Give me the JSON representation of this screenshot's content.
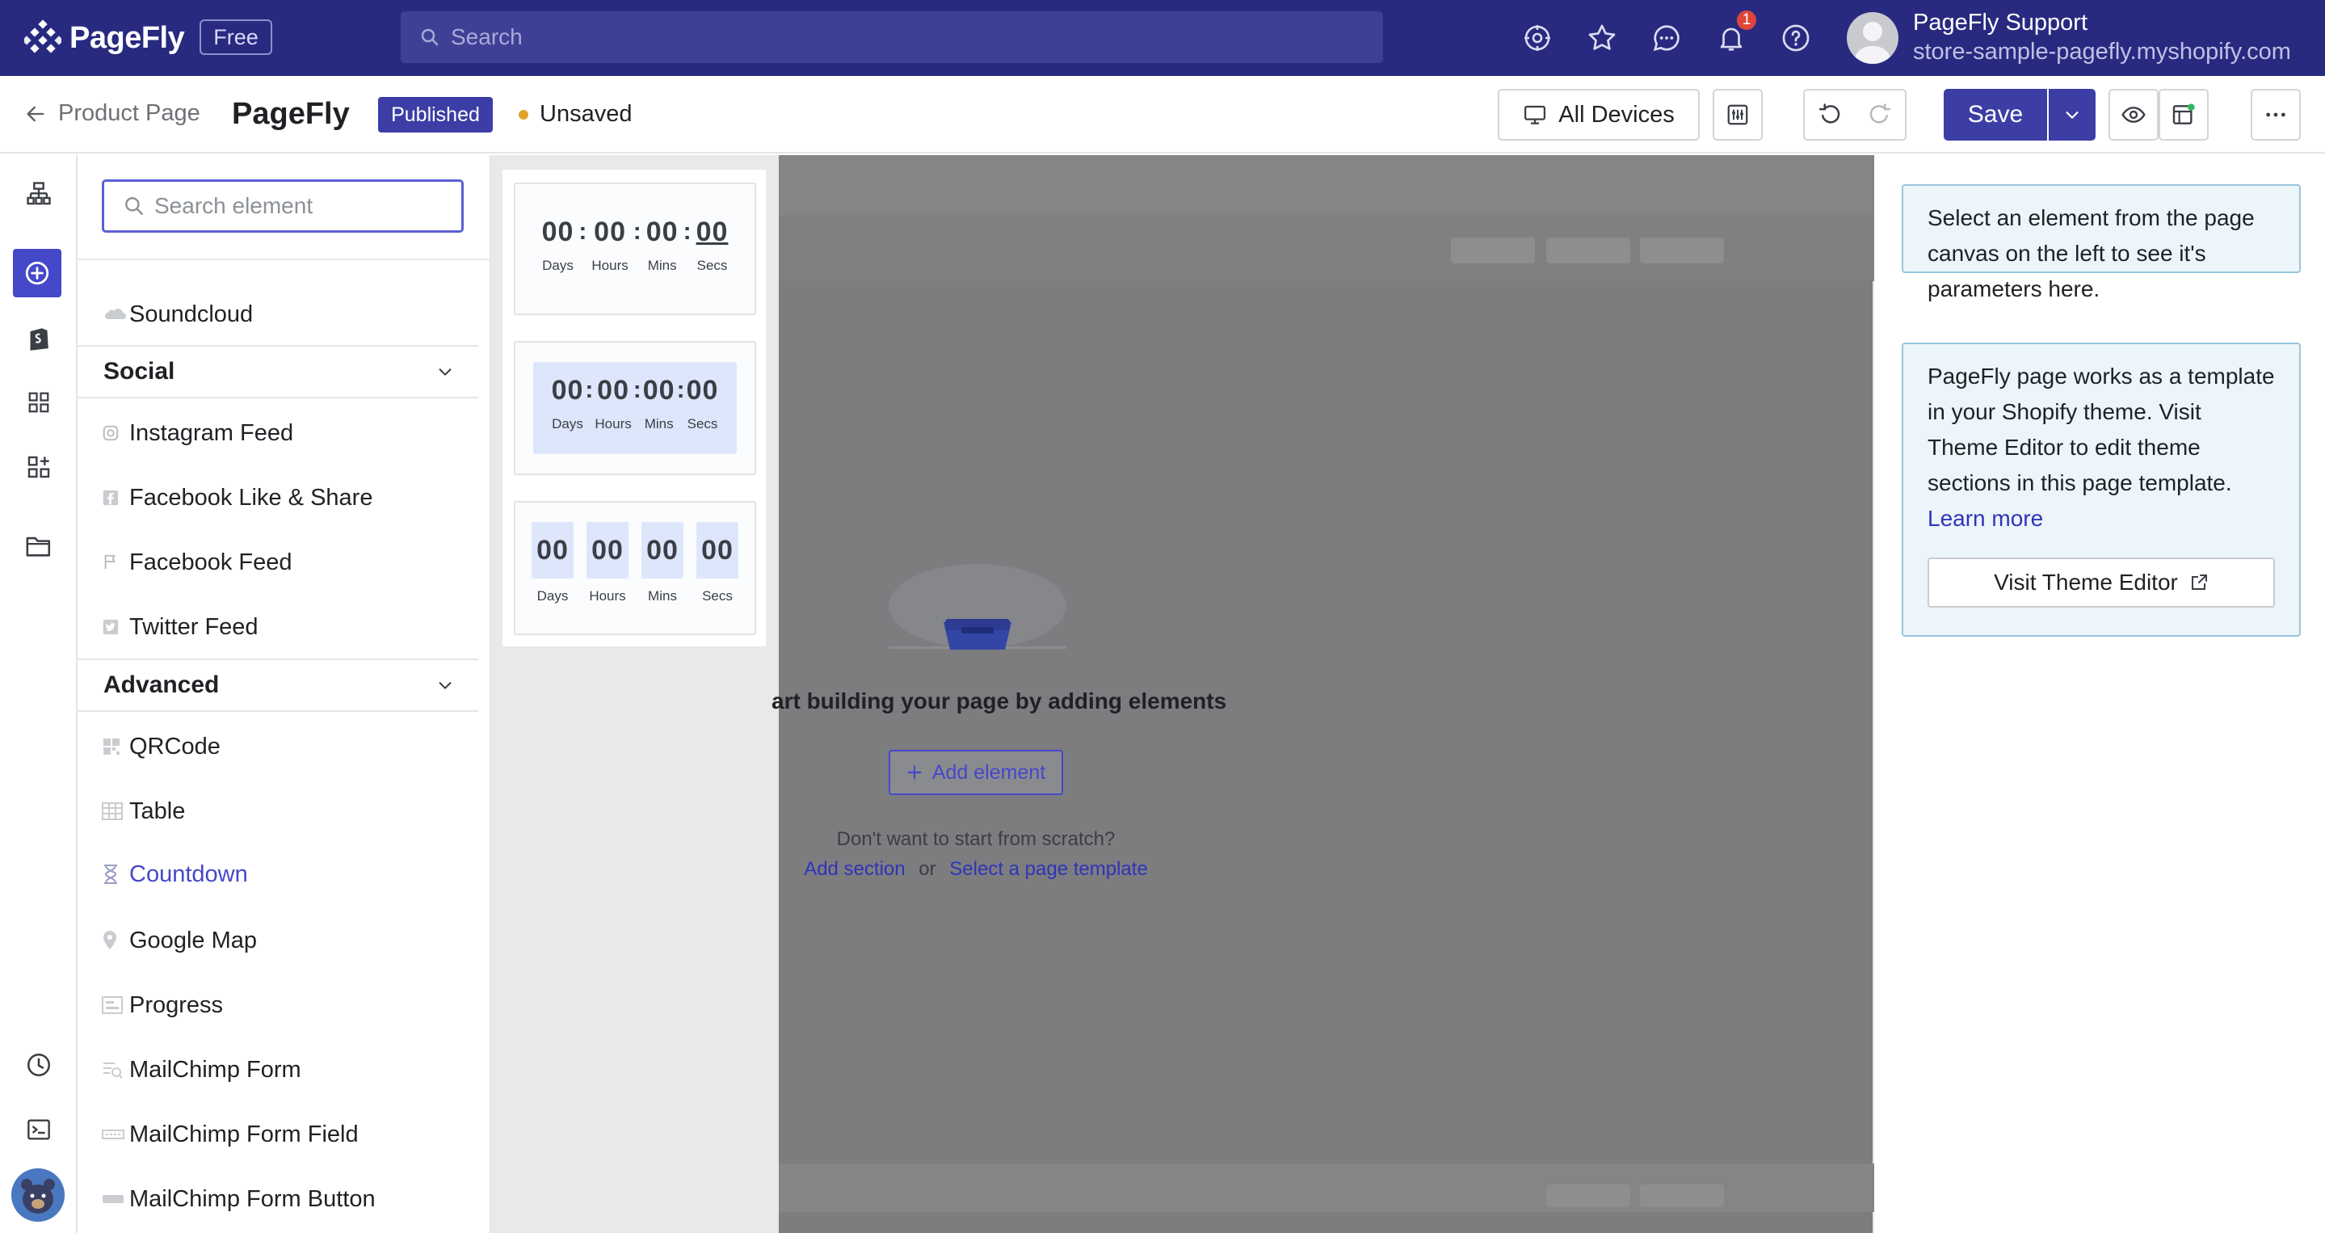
{
  "topbar": {
    "logo_text": "PageFly",
    "plan": "Free",
    "search_placeholder": "Search",
    "notification_count": "1",
    "user_name": "PageFly Support",
    "user_store": "store-sample-pagefly.myshopify.com",
    "icons": [
      "settings-gear-icon",
      "star-icon",
      "chat-icon",
      "bell-icon",
      "help-icon"
    ]
  },
  "subbar": {
    "back_label": "Product Page",
    "page_title": "PageFly",
    "status_badge": "Published",
    "save_state": "Unsaved",
    "devices_label": "All Devices",
    "save_label": "Save"
  },
  "element_panel": {
    "search_placeholder": "Search element",
    "items_top": [
      {
        "label": "Soundcloud",
        "icon": "soundcloud-icon"
      }
    ],
    "groups": [
      {
        "title": "Social",
        "items": [
          {
            "label": "Instagram Feed",
            "icon": "instagram-icon"
          },
          {
            "label": "Facebook Like & Share",
            "icon": "facebook-icon"
          },
          {
            "label": "Facebook Feed",
            "icon": "flag-icon"
          },
          {
            "label": "Twitter Feed",
            "icon": "twitter-icon"
          }
        ]
      },
      {
        "title": "Advanced",
        "items": [
          {
            "label": "QRCode",
            "icon": "qrcode-icon"
          },
          {
            "label": "Table",
            "icon": "table-icon"
          },
          {
            "label": "Countdown",
            "icon": "hourglass-icon"
          },
          {
            "label": "Google Map",
            "icon": "map-pin-icon"
          },
          {
            "label": "Progress",
            "icon": "progress-icon"
          },
          {
            "label": "MailChimp Form",
            "icon": "form-icon"
          },
          {
            "label": "MailChimp Form Field",
            "icon": "field-icon"
          },
          {
            "label": "MailChimp Form Button",
            "icon": "button-icon"
          }
        ]
      }
    ]
  },
  "countdown_variants": {
    "num": "00",
    "sep": ":",
    "labels": {
      "days": "Days",
      "hours": "Hours",
      "mins": "Mins",
      "secs": "Secs"
    }
  },
  "canvas": {
    "empty_title": "art building your page by adding elements",
    "add_element_label": "Add element",
    "scratch_question": "Don't want to start from scratch?",
    "add_section_link": "Add section",
    "or_text": "or",
    "template_link": "Select a page template"
  },
  "right_panel": {
    "hint_text": "Select an element from the page canvas on the left to see it's parameters here.",
    "theme_text": "PageFly page works as a template in your Shopify theme. Visit Theme Editor to edit theme sections in this page template.",
    "learn_more": "Learn more",
    "visit_theme_label": "Visit Theme Editor"
  },
  "colors": {
    "topbar_bg": "#282a80",
    "accent": "#4548c9",
    "published_badge": "#3c3ea6",
    "info_card_bg": "#ebf5fa",
    "notification_red": "#e0453a"
  }
}
